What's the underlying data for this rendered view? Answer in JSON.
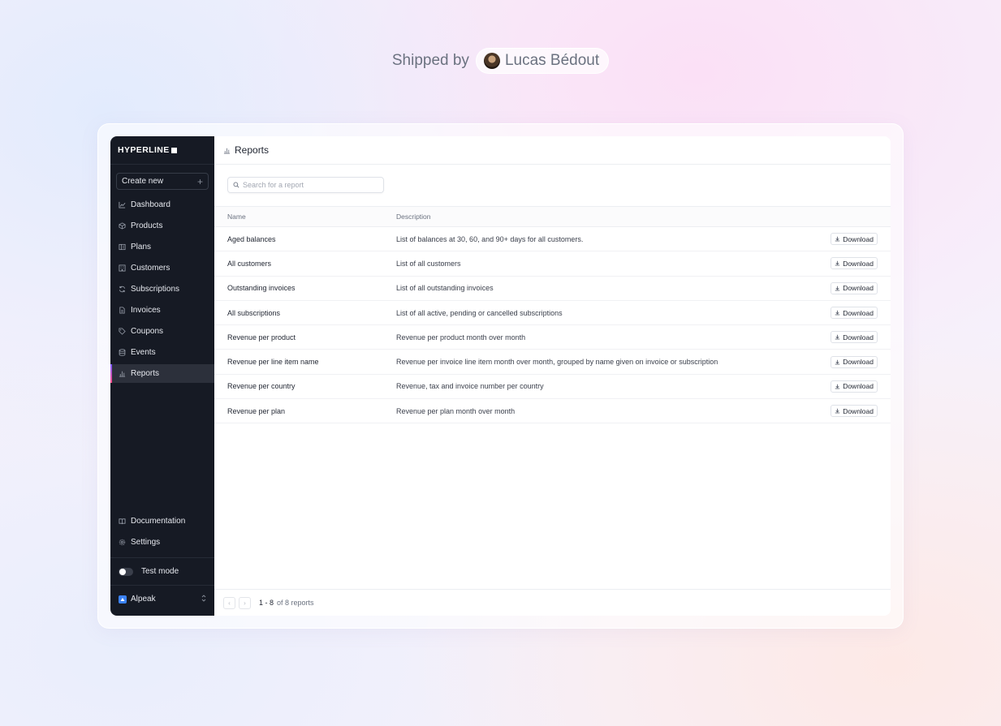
{
  "header": {
    "shipped_by": "Shipped by",
    "author": "Lucas Bédout"
  },
  "sidebar": {
    "logo": "HYPERLINE",
    "create_new": "Create new",
    "items": [
      {
        "label": "Dashboard",
        "icon": "chart-line-icon",
        "active": false
      },
      {
        "label": "Products",
        "icon": "box-icon",
        "active": false
      },
      {
        "label": "Plans",
        "icon": "plans-icon",
        "active": false
      },
      {
        "label": "Customers",
        "icon": "building-icon",
        "active": false
      },
      {
        "label": "Subscriptions",
        "icon": "refresh-icon",
        "active": false
      },
      {
        "label": "Invoices",
        "icon": "file-icon",
        "active": false
      },
      {
        "label": "Coupons",
        "icon": "tag-icon",
        "active": false
      },
      {
        "label": "Events",
        "icon": "database-icon",
        "active": false
      },
      {
        "label": "Reports",
        "icon": "bar-chart-icon",
        "active": true
      }
    ],
    "bottom": {
      "documentation": "Documentation",
      "settings": "Settings",
      "test_mode": "Test mode",
      "workspace": "Alpeak"
    },
    "accent_gradient": [
      "#7c5cff",
      "#ff4f8b"
    ]
  },
  "main": {
    "page_title": "Reports",
    "search": {
      "placeholder": "Search for a report"
    },
    "columns": {
      "name": "Name",
      "description": "Description"
    },
    "download_label": "Download",
    "rows": [
      {
        "name": "Aged balances",
        "description": "List of balances at 30, 60, and 90+ days for all customers."
      },
      {
        "name": "All customers",
        "description": "List of all customers"
      },
      {
        "name": "Outstanding invoices",
        "description": "List of all outstanding invoices"
      },
      {
        "name": "All subscriptions",
        "description": "List of all active, pending or cancelled subscriptions"
      },
      {
        "name": "Revenue per product",
        "description": "Revenue per product month over month"
      },
      {
        "name": "Revenue per line item name",
        "description": "Revenue per invoice line item month over month, grouped by name given on invoice or subscription"
      },
      {
        "name": "Revenue per country",
        "description": "Revenue, tax and invoice number per country"
      },
      {
        "name": "Revenue per plan",
        "description": "Revenue per plan month over month"
      }
    ],
    "pagination": {
      "range": "1 - 8",
      "of_text": "of 8 reports"
    }
  }
}
